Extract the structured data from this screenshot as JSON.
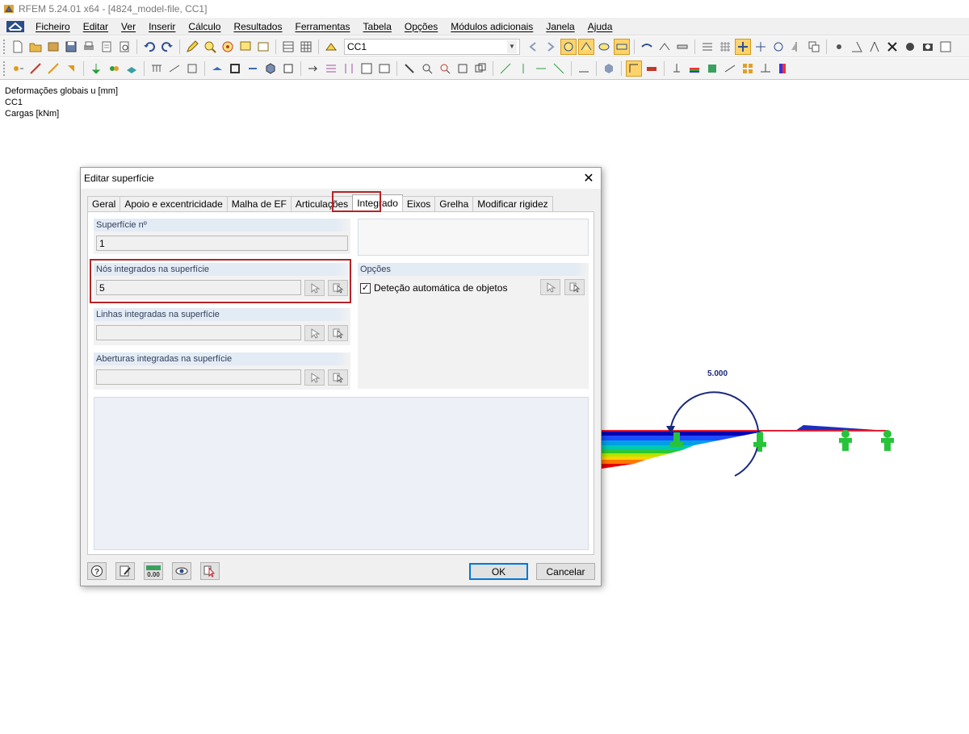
{
  "window": {
    "title": "RFEM 5.24.01 x64 - [4824_model-file, CC1]"
  },
  "menu": {
    "items": [
      "Ficheiro",
      "Editar",
      "Ver",
      "Inserir",
      "Cálculo",
      "Resultados",
      "Ferramentas",
      "Tabela",
      "Opções",
      "Módulos adicionais",
      "Janela",
      "Ajuda"
    ]
  },
  "toolbar": {
    "load_case": "CC1"
  },
  "workspace": {
    "info": [
      "Deformações globais u [mm]",
      "CC1",
      "Cargas [kNm]"
    ],
    "moment_label": "5.000"
  },
  "dialog": {
    "title": "Editar superfície",
    "tabs": [
      "Geral",
      "Apoio e excentricidade",
      "Malha de EF",
      "Articulações",
      "Integrado",
      "Eixos",
      "Grelha",
      "Modificar rigidez"
    ],
    "selected_tab": "Integrado",
    "surface_no": {
      "label": "Superfície nº",
      "value": "1"
    },
    "nodes": {
      "label": "Nós integrados na superfície",
      "value": "5"
    },
    "lines": {
      "label": "Linhas integradas na superfície",
      "value": ""
    },
    "openings": {
      "label": "Aberturas integradas na superfície",
      "value": ""
    },
    "options": {
      "label": "Opções",
      "auto_detect": {
        "label": "Deteção automática de objetos",
        "checked": true
      }
    },
    "buttons": {
      "ok": "OK",
      "cancel": "Cancelar"
    }
  },
  "colors": {
    "highlight": "#b52327",
    "group_header": "#e3ebf5",
    "support_green": "#27c43a"
  }
}
